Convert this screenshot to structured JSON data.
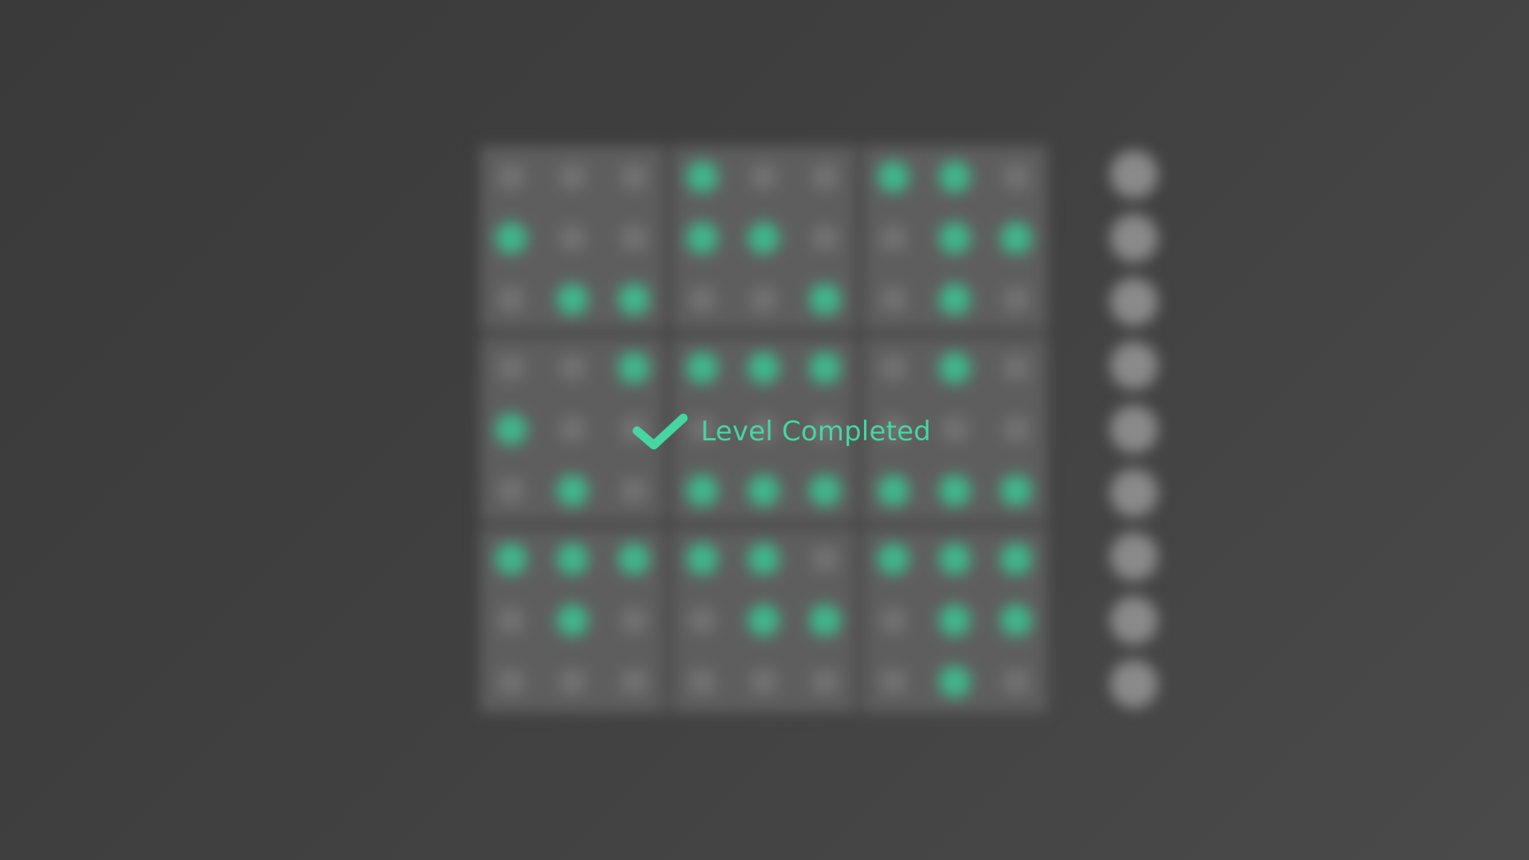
{
  "colors": {
    "accent": "#45d6a2",
    "background": "#404040",
    "cell_block": "#5e5e5e",
    "dot_off": "#727272",
    "dot_on": "#3fb88c",
    "side_button": "#8a8a8a"
  },
  "status": {
    "icon": "check-icon",
    "message": "Level Completed"
  },
  "board": {
    "rows": 9,
    "cols": 9,
    "lit": [
      [
        0,
        0,
        0,
        1,
        0,
        0,
        1,
        1,
        0
      ],
      [
        1,
        0,
        0,
        1,
        1,
        0,
        0,
        1,
        1
      ],
      [
        0,
        1,
        1,
        0,
        0,
        1,
        0,
        1,
        0
      ],
      [
        0,
        0,
        1,
        1,
        1,
        1,
        0,
        1,
        0
      ],
      [
        1,
        0,
        0,
        0,
        0,
        0,
        0,
        0,
        0
      ],
      [
        0,
        1,
        0,
        1,
        1,
        1,
        1,
        1,
        1
      ],
      [
        1,
        1,
        1,
        1,
        1,
        0,
        1,
        1,
        1
      ],
      [
        0,
        1,
        0,
        0,
        1,
        1,
        0,
        1,
        1
      ],
      [
        0,
        0,
        0,
        0,
        0,
        0,
        0,
        1,
        0
      ]
    ]
  },
  "side_buttons": {
    "count": 9
  }
}
